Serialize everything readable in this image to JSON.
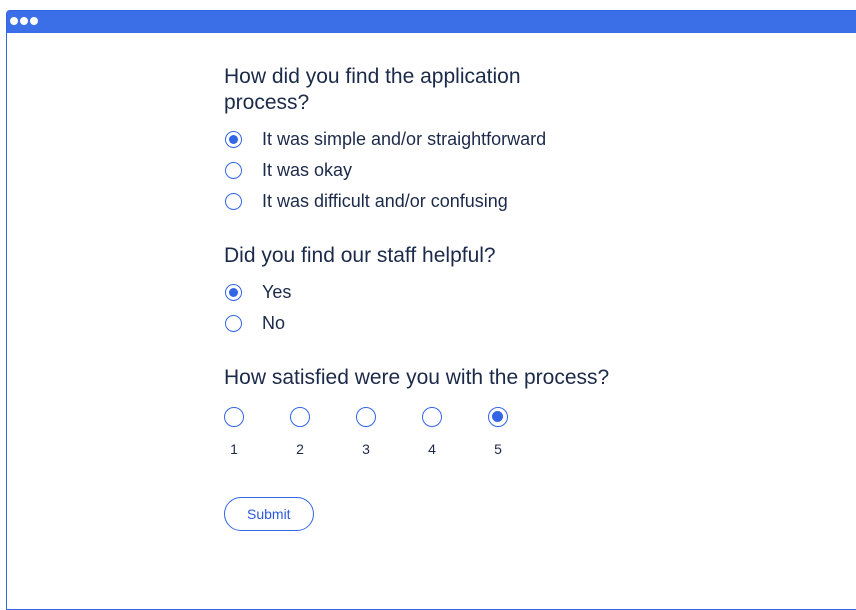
{
  "form": {
    "questions": [
      {
        "text": "How did you find the application process?",
        "options": [
          {
            "label": "It was simple and/or straightforward",
            "checked": true
          },
          {
            "label": "It was okay",
            "checked": false
          },
          {
            "label": "It was difficult and/or confusing",
            "checked": false
          }
        ]
      },
      {
        "text": "Did you find our staff helpful?",
        "options": [
          {
            "label": "Yes",
            "checked": true
          },
          {
            "label": "No",
            "checked": false
          }
        ]
      },
      {
        "text": "How satisfied were you with the process?",
        "scale": [
          {
            "label": "1",
            "checked": false
          },
          {
            "label": "2",
            "checked": false
          },
          {
            "label": "3",
            "checked": false
          },
          {
            "label": "4",
            "checked": false
          },
          {
            "label": "5",
            "checked": true
          }
        ]
      }
    ],
    "submit_label": "Submit"
  },
  "colors": {
    "accent": "#3366e6",
    "titlebar": "#3b6fe8",
    "text": "#1c2a4a"
  },
  "icons": {
    "window_controls": "three-dots-icon"
  }
}
